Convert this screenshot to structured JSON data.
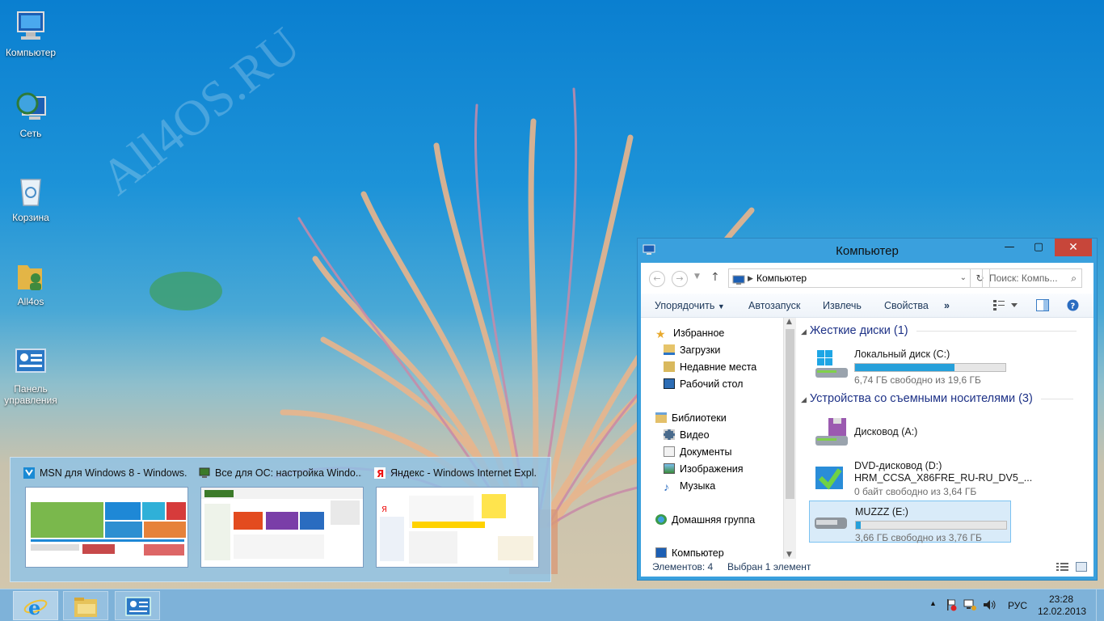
{
  "desktop": {
    "watermark": "All4OS.RU",
    "icons": [
      {
        "label": "Компьютер"
      },
      {
        "label": "Сеть"
      },
      {
        "label": "Корзина"
      },
      {
        "label": "All4os"
      },
      {
        "label": "Панель управления"
      }
    ]
  },
  "explorer": {
    "title": "Компьютер",
    "address": "Компьютер",
    "search_placeholder": "Поиск: Компь...",
    "toolbar": {
      "organize": "Упорядочить",
      "autoplay": "Автозапуск",
      "eject": "Извлечь",
      "properties": "Свойства",
      "more": "»"
    },
    "nav": {
      "favorites": "Избранное",
      "downloads": "Загрузки",
      "recent": "Недавние места",
      "desktop": "Рабочий стол",
      "libraries": "Библиотеки",
      "video": "Видео",
      "documents": "Документы",
      "images": "Изображения",
      "music": "Музыка",
      "homegroup": "Домашняя группа",
      "computer": "Компьютер"
    },
    "groups": {
      "hdd": "Жесткие диски (1)",
      "removable": "Устройства со съемными носителями (3)"
    },
    "drives": [
      {
        "name": "Локальный диск (C:)",
        "free": "6,74 ГБ свободно из 19,6 ГБ",
        "used_fraction": 0.66
      },
      {
        "name": "Дисковод (A:)"
      },
      {
        "name": "DVD-дисковод (D:)",
        "name2": "HRM_CCSA_X86FRE_RU-RU_DV5_...",
        "free": "0 байт свободно из 3,64 ГБ"
      },
      {
        "name": "MUZZZ (E:)",
        "free": "3,66 ГБ свободно из 3,76 ГБ",
        "used_fraction": 0.03
      }
    ],
    "status": {
      "items": "Элементов: 4",
      "selected": "Выбран 1 элемент"
    }
  },
  "thumbnails": [
    {
      "title": "MSN для Windows 8 - Windows..."
    },
    {
      "title": "Все для ОС: настройка Windo..."
    },
    {
      "title": "Яндекс - Windows Internet Expl..."
    }
  ],
  "taskbar": {
    "lang": "РУС",
    "time": "23:28",
    "date": "12.02.2013"
  }
}
